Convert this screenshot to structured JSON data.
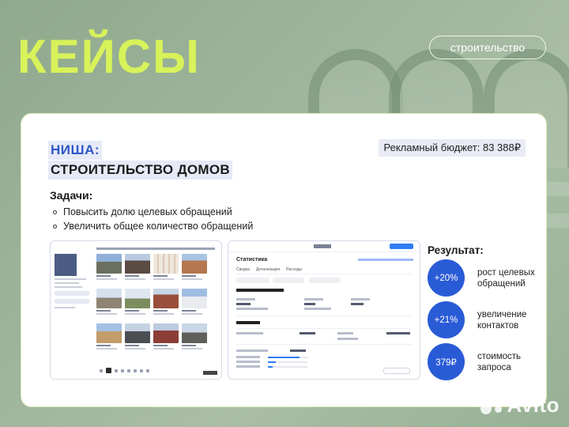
{
  "header": {
    "title": "КЕЙСЫ",
    "tag": "строительство"
  },
  "niche": {
    "label": "НИША:",
    "value": "СТРОИТЕЛЬСТВО ДОМОВ"
  },
  "budget": "Рекламный бюджет: 83 388₽",
  "tasks": {
    "heading": "Задачи:",
    "items": [
      "Повысить долю целевых обращений",
      "Увеличить общее количество обращений"
    ]
  },
  "stats_screen": {
    "title": "Статистика",
    "tabs": [
      "Сводка",
      "Детализация",
      "Расходы"
    ]
  },
  "results": {
    "heading": "Результат:",
    "items": [
      {
        "value": "+20%",
        "label": "рост целевых обращений"
      },
      {
        "value": "+21%",
        "label": "увеличение контактов"
      },
      {
        "value": "379₽",
        "label": "стоимость запроса"
      }
    ]
  },
  "colors": {
    "accent": "#d8f25a",
    "blue": "#2a5bd7",
    "niche_blue": "#2f58c7"
  },
  "logo": {
    "text": "Avito"
  }
}
